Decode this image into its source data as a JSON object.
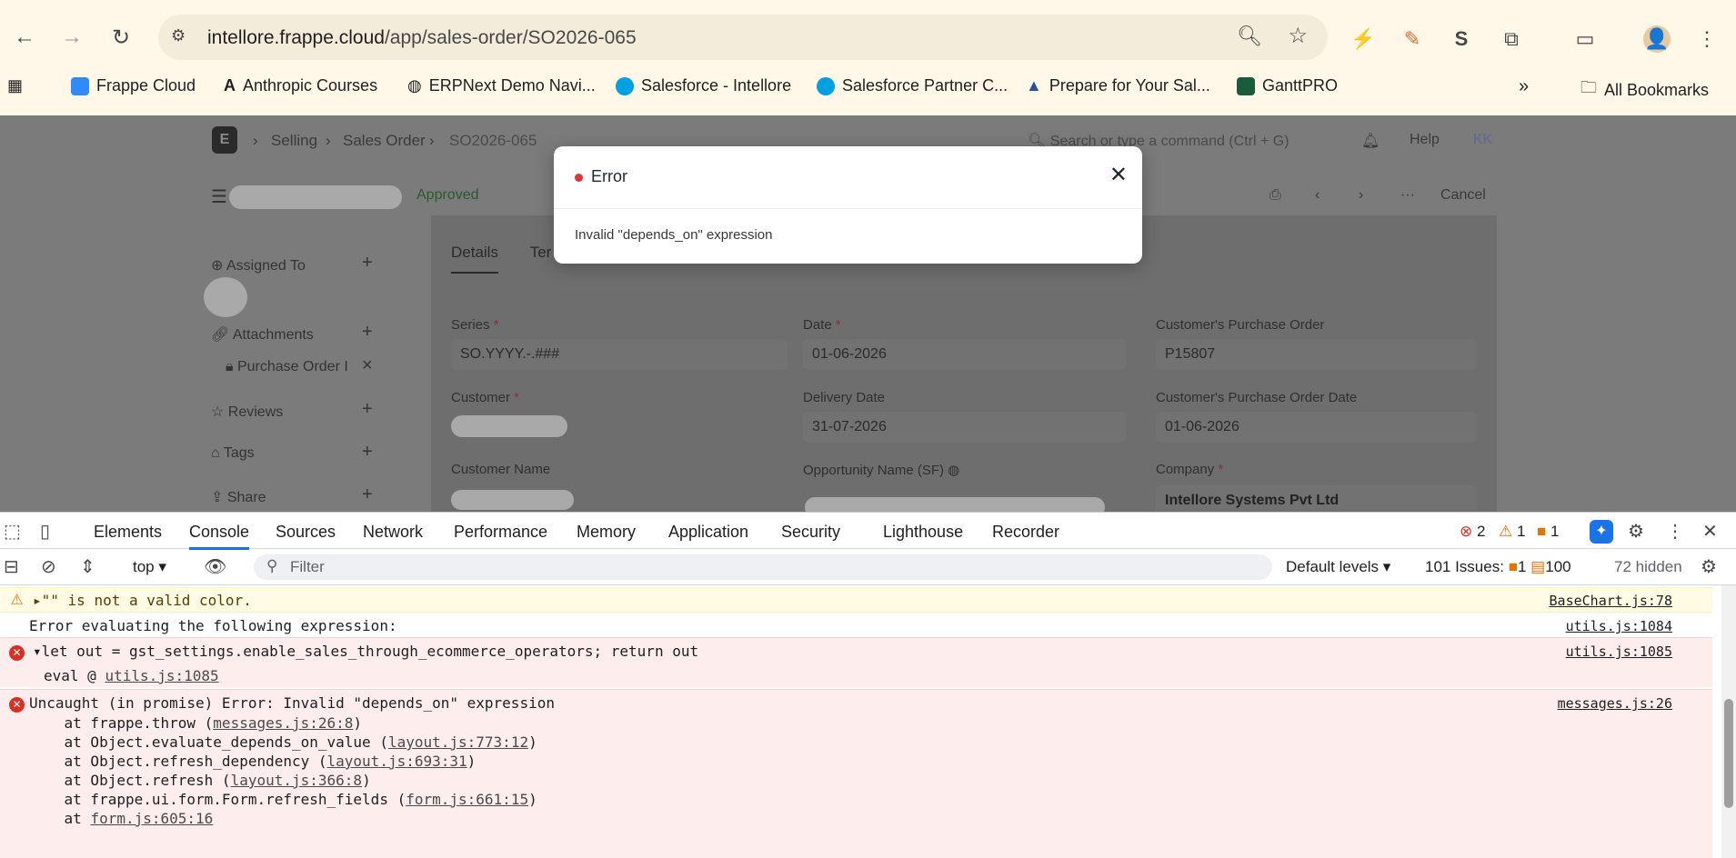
{
  "browser": {
    "url_host": "intellore.frappe.cloud",
    "url_path": "/app/sales-order/SO2026-065",
    "bookmarks": [
      {
        "label": "Frappe Cloud",
        "color": "#2f8bf7"
      },
      {
        "label": "Anthropic Courses",
        "color": "#1f1f1f"
      },
      {
        "label": "ERPNext Demo Navi...",
        "color": "#3c3c3c"
      },
      {
        "label": "Salesforce - Intellore",
        "color": "#00a1e0"
      },
      {
        "label": "Salesforce Partner C...",
        "color": "#00a1e0"
      },
      {
        "label": "Prepare for Your Sal...",
        "color": "#2a4fa0"
      },
      {
        "label": "GanttPRO",
        "color": "#1a5b3c"
      }
    ],
    "all_bookmarks": "All Bookmarks",
    "more": "»"
  },
  "app": {
    "breadcrumbs": [
      "Selling",
      "Sales Order",
      "SO2026-065"
    ],
    "search_placeholder": "Search or type a command (Ctrl + G)",
    "help": "Help",
    "avatar": "KK",
    "status": "Approved",
    "cancel": "Cancel",
    "sidebar": {
      "assigned_to": "Assigned To",
      "attachments": "Attachments",
      "attachment_file": "Purchase Order I",
      "reviews": "Reviews",
      "tags": "Tags",
      "share": "Share"
    },
    "tabs": [
      "Details",
      "Ter"
    ],
    "fields": {
      "series_label": "Series",
      "series_value": "SO.YYYY.-.###",
      "date_label": "Date",
      "date_value": "01-06-2026",
      "cpo_label": "Customer's Purchase Order",
      "cpo_value": "P15807",
      "customer_label": "Customer",
      "delivery_label": "Delivery Date",
      "delivery_value": "31-07-2026",
      "cpo_date_label": "Customer's Purchase Order Date",
      "cpo_date_value": "01-06-2026",
      "customer_name_label": "Customer Name",
      "opportunity_label": "Opportunity Name (SF)",
      "company_label": "Company",
      "company_value": "Intellore Systems Pvt Ltd"
    }
  },
  "modal": {
    "title": "Error",
    "message": "Invalid \"depends_on\" expression"
  },
  "devtools": {
    "tabs": [
      "Elements",
      "Console",
      "Sources",
      "Network",
      "Performance",
      "Memory",
      "Application",
      "Security",
      "Lighthouse",
      "Recorder"
    ],
    "error_count": "2",
    "warn_count": "1",
    "issue_count": "1",
    "context": "top",
    "filter_placeholder": "Filter",
    "levels": "Default levels",
    "issues_label": "101 Issues:",
    "issues_warn": "1",
    "issues_info": "100",
    "hidden": "72 hidden",
    "console": {
      "warn_msg": "\"\" is not a valid color.",
      "warn_src": "BaseChart.js:78",
      "eval_msg": "Error evaluating the following expression:",
      "eval_src": "utils.js:1084",
      "expr_msg": "let out = gst_settings.enable_sales_through_ecommerce_operators; return out",
      "expr_src": "utils.js:1085",
      "eval_at_prefix": "eval @ ",
      "eval_at_link": "utils.js:1085",
      "uncaught_msg": "Uncaught (in promise) Error: Invalid \"depends_on\" expression",
      "uncaught_src": "messages.js:26",
      "stack": [
        {
          "prefix": "    at frappe.throw (",
          "link": "messages.js:26:8",
          "suffix": ")"
        },
        {
          "prefix": "    at Object.evaluate_depends_on_value (",
          "link": "layout.js:773:12",
          "suffix": ")"
        },
        {
          "prefix": "    at Object.refresh_dependency (",
          "link": "layout.js:693:31",
          "suffix": ")"
        },
        {
          "prefix": "    at Object.refresh (",
          "link": "layout.js:366:8",
          "suffix": ")"
        },
        {
          "prefix": "    at frappe.ui.form.Form.refresh_fields (",
          "link": "form.js:661:15",
          "suffix": ")"
        },
        {
          "prefix": "    at ",
          "link": "form.js:605:16",
          "suffix": ""
        }
      ]
    }
  }
}
